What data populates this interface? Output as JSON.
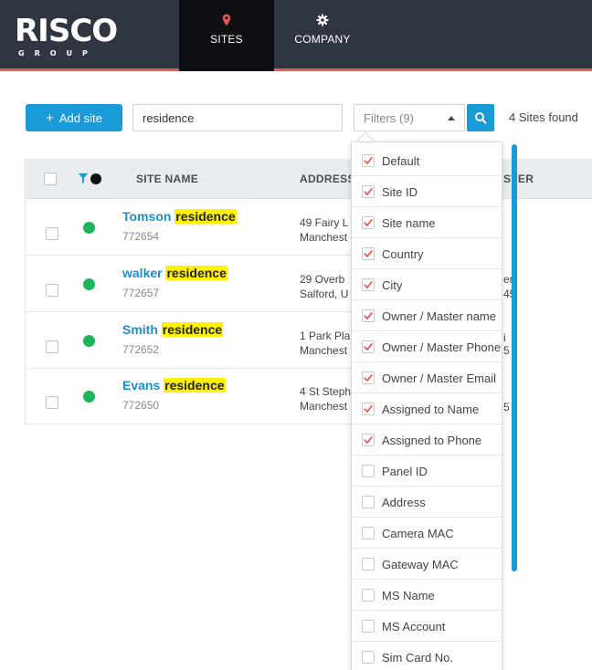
{
  "header": {
    "logo_main": "RISCO",
    "logo_sub": "GROUP",
    "tabs": [
      {
        "label": "SITES",
        "icon": "map-pin-icon",
        "active": true
      },
      {
        "label": "COMPANY",
        "icon": "gear-icon",
        "active": false
      }
    ],
    "accent_color": "#e85a4f"
  },
  "toolbar": {
    "add_label": "Add site",
    "search_value": "residence",
    "filters_label": "Filters (9)",
    "results_text": "4 Sites found"
  },
  "table": {
    "columns": [
      "SITE NAME",
      "ADDRESS",
      "OWNER / MASTER"
    ],
    "rows": [
      {
        "name": "Tomson",
        "match": "residence",
        "id": "772654",
        "addr1": "49 Fairy L",
        "addr2": "Manchest",
        "extra1": "",
        "extra2": "",
        "status": "online"
      },
      {
        "name": "walker",
        "match": "residence",
        "id": "772657",
        "addr1": "29 Overb",
        "addr2": "Salford, U",
        "extra1": "er",
        "extra2": "45",
        "status": "online"
      },
      {
        "name": "Smith",
        "match": "residence",
        "id": "772652",
        "addr1": "1 Park Pla",
        "addr2": "Manchest",
        "extra1": "i",
        "extra2": "5",
        "status": "online"
      },
      {
        "name": "Evans",
        "match": "residence",
        "id": "772650",
        "addr1": "4 St Steph",
        "addr2": "Manchest",
        "extra1": "",
        "extra2": "5",
        "status": "online"
      }
    ],
    "status_color": "#1db45a"
  },
  "filters": {
    "options": [
      {
        "label": "Default",
        "checked": true
      },
      {
        "label": "Site ID",
        "checked": true
      },
      {
        "label": "Site name",
        "checked": true
      },
      {
        "label": "Country",
        "checked": true
      },
      {
        "label": "City",
        "checked": true
      },
      {
        "label": "Owner / Master name",
        "checked": true
      },
      {
        "label": "Owner / Master Phone",
        "checked": true
      },
      {
        "label": "Owner / Master Email",
        "checked": true
      },
      {
        "label": "Assigned to Name",
        "checked": true
      },
      {
        "label": "Assigned to Phone",
        "checked": true
      },
      {
        "label": "Panel ID",
        "checked": false
      },
      {
        "label": "Address",
        "checked": false
      },
      {
        "label": "Camera MAC",
        "checked": false
      },
      {
        "label": "Gateway MAC",
        "checked": false
      },
      {
        "label": "MS Name",
        "checked": false
      },
      {
        "label": "MS Account",
        "checked": false
      },
      {
        "label": "Sim Card No.",
        "checked": false
      }
    ],
    "check_color": "#e85a4f"
  },
  "colors": {
    "primary": "#1a9ad6",
    "highlight": "#fff200",
    "header_bg": "#303641"
  }
}
